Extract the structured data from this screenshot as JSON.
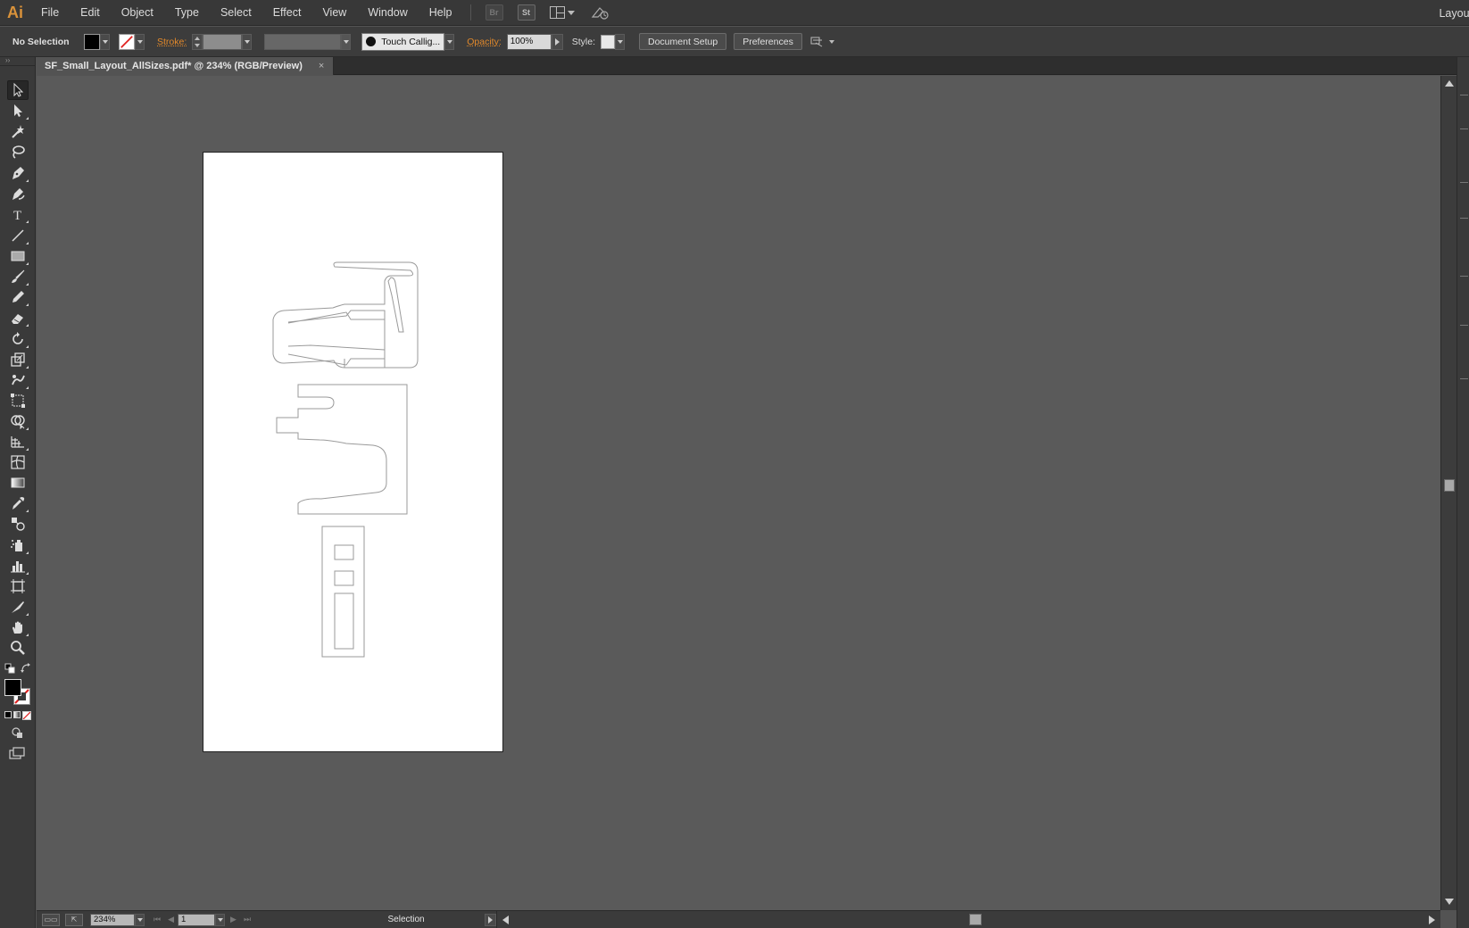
{
  "app": {
    "logo": "Ai",
    "workspace": "Layout"
  },
  "menu": {
    "items": [
      "File",
      "Edit",
      "Object",
      "Type",
      "Select",
      "Effect",
      "View",
      "Window",
      "Help"
    ],
    "bridge_label": "Br",
    "stock_label": "St"
  },
  "control": {
    "selection": "No Selection",
    "stroke_label": "Stroke:",
    "brush": "Touch Callig...",
    "opacity_label": "Opacity:",
    "opacity_value": "100%",
    "style_label": "Style:",
    "document_setup": "Document Setup",
    "preferences": "Preferences"
  },
  "document": {
    "tab_title": "SF_Small_Layout_AllSizes.pdf* @ 234% (RGB/Preview)",
    "close": "×"
  },
  "status": {
    "zoom": "234%",
    "artboard": "1",
    "tool": "Selection"
  },
  "colors": {
    "accent": "#e3892a",
    "logo": "#d9923a",
    "canvas": "#5a5a5a",
    "chrome": "#3a3a3a"
  },
  "tools": [
    "selection-tool-icon",
    "direct-selection-tool-icon",
    "magic-wand-tool-icon",
    "lasso-tool-icon",
    "pen-tool-icon",
    "curvature-tool-icon",
    "type-tool-icon",
    "line-segment-tool-icon",
    "rectangle-tool-icon",
    "paintbrush-tool-icon",
    "pencil-tool-icon",
    "eraser-tool-icon",
    "rotate-tool-icon",
    "scale-tool-icon",
    "warp-tool-icon",
    "free-transform-tool-icon",
    "shape-builder-tool-icon",
    "perspective-grid-tool-icon",
    "mesh-tool-icon",
    "gradient-tool-icon",
    "eyedropper-tool-icon",
    "blend-tool-icon",
    "symbol-sprayer-tool-icon",
    "column-graph-tool-icon",
    "artboard-tool-icon",
    "slice-tool-icon",
    "hand-tool-icon",
    "zoom-tool-icon"
  ]
}
